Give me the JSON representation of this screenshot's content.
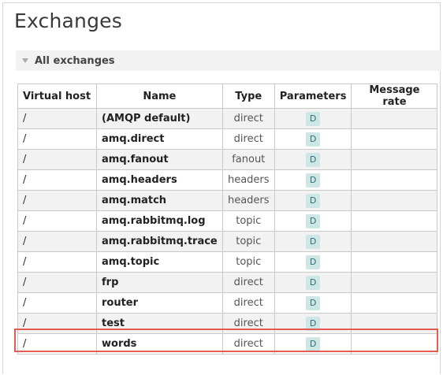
{
  "page": {
    "title": "Exchanges"
  },
  "section": {
    "label": "All exchanges"
  },
  "table": {
    "headers": [
      "Virtual host",
      "Name",
      "Type",
      "Parameters",
      "Message rate"
    ],
    "rows": [
      {
        "vhost": "/",
        "name": "(AMQP default)",
        "type": "direct",
        "param": "D"
      },
      {
        "vhost": "/",
        "name": "amq.direct",
        "type": "direct",
        "param": "D"
      },
      {
        "vhost": "/",
        "name": "amq.fanout",
        "type": "fanout",
        "param": "D"
      },
      {
        "vhost": "/",
        "name": "amq.headers",
        "type": "headers",
        "param": "D"
      },
      {
        "vhost": "/",
        "name": "amq.match",
        "type": "headers",
        "param": "D"
      },
      {
        "vhost": "/",
        "name": "amq.rabbitmq.log",
        "type": "topic",
        "param": "D"
      },
      {
        "vhost": "/",
        "name": "amq.rabbitmq.trace",
        "type": "topic",
        "param": "D"
      },
      {
        "vhost": "/",
        "name": "amq.topic",
        "type": "topic",
        "param": "D"
      },
      {
        "vhost": "/",
        "name": "frp",
        "type": "direct",
        "param": "D"
      },
      {
        "vhost": "/",
        "name": "router",
        "type": "direct",
        "param": "D"
      },
      {
        "vhost": "/",
        "name": "test",
        "type": "direct",
        "param": "D"
      },
      {
        "vhost": "/",
        "name": "words",
        "type": "direct",
        "param": "D"
      }
    ],
    "highlighted_row": "test"
  },
  "colors": {
    "highlight_border": "#e25c52",
    "badge_bg": "#cfe6e7",
    "stripe_bg": "#f2f2f2"
  }
}
